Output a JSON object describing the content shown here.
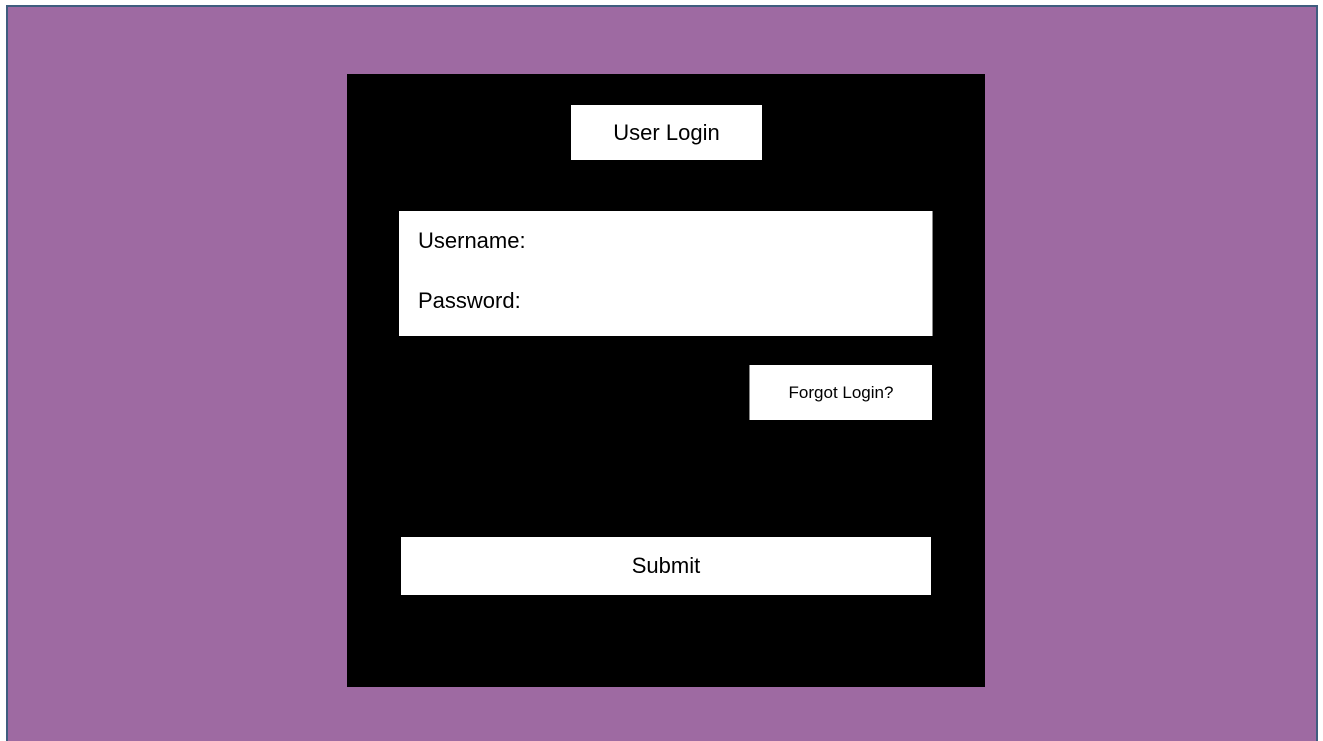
{
  "login": {
    "title": "User Login",
    "username_label": "Username:",
    "username_value": "",
    "password_label": "Password:",
    "password_value": "",
    "forgot_label": "Forgot Login?",
    "submit_label": "Submit"
  },
  "colors": {
    "background": "#9e6aa2",
    "border": "#3f5d7f",
    "panel": "#000000",
    "box": "#ffffff"
  }
}
